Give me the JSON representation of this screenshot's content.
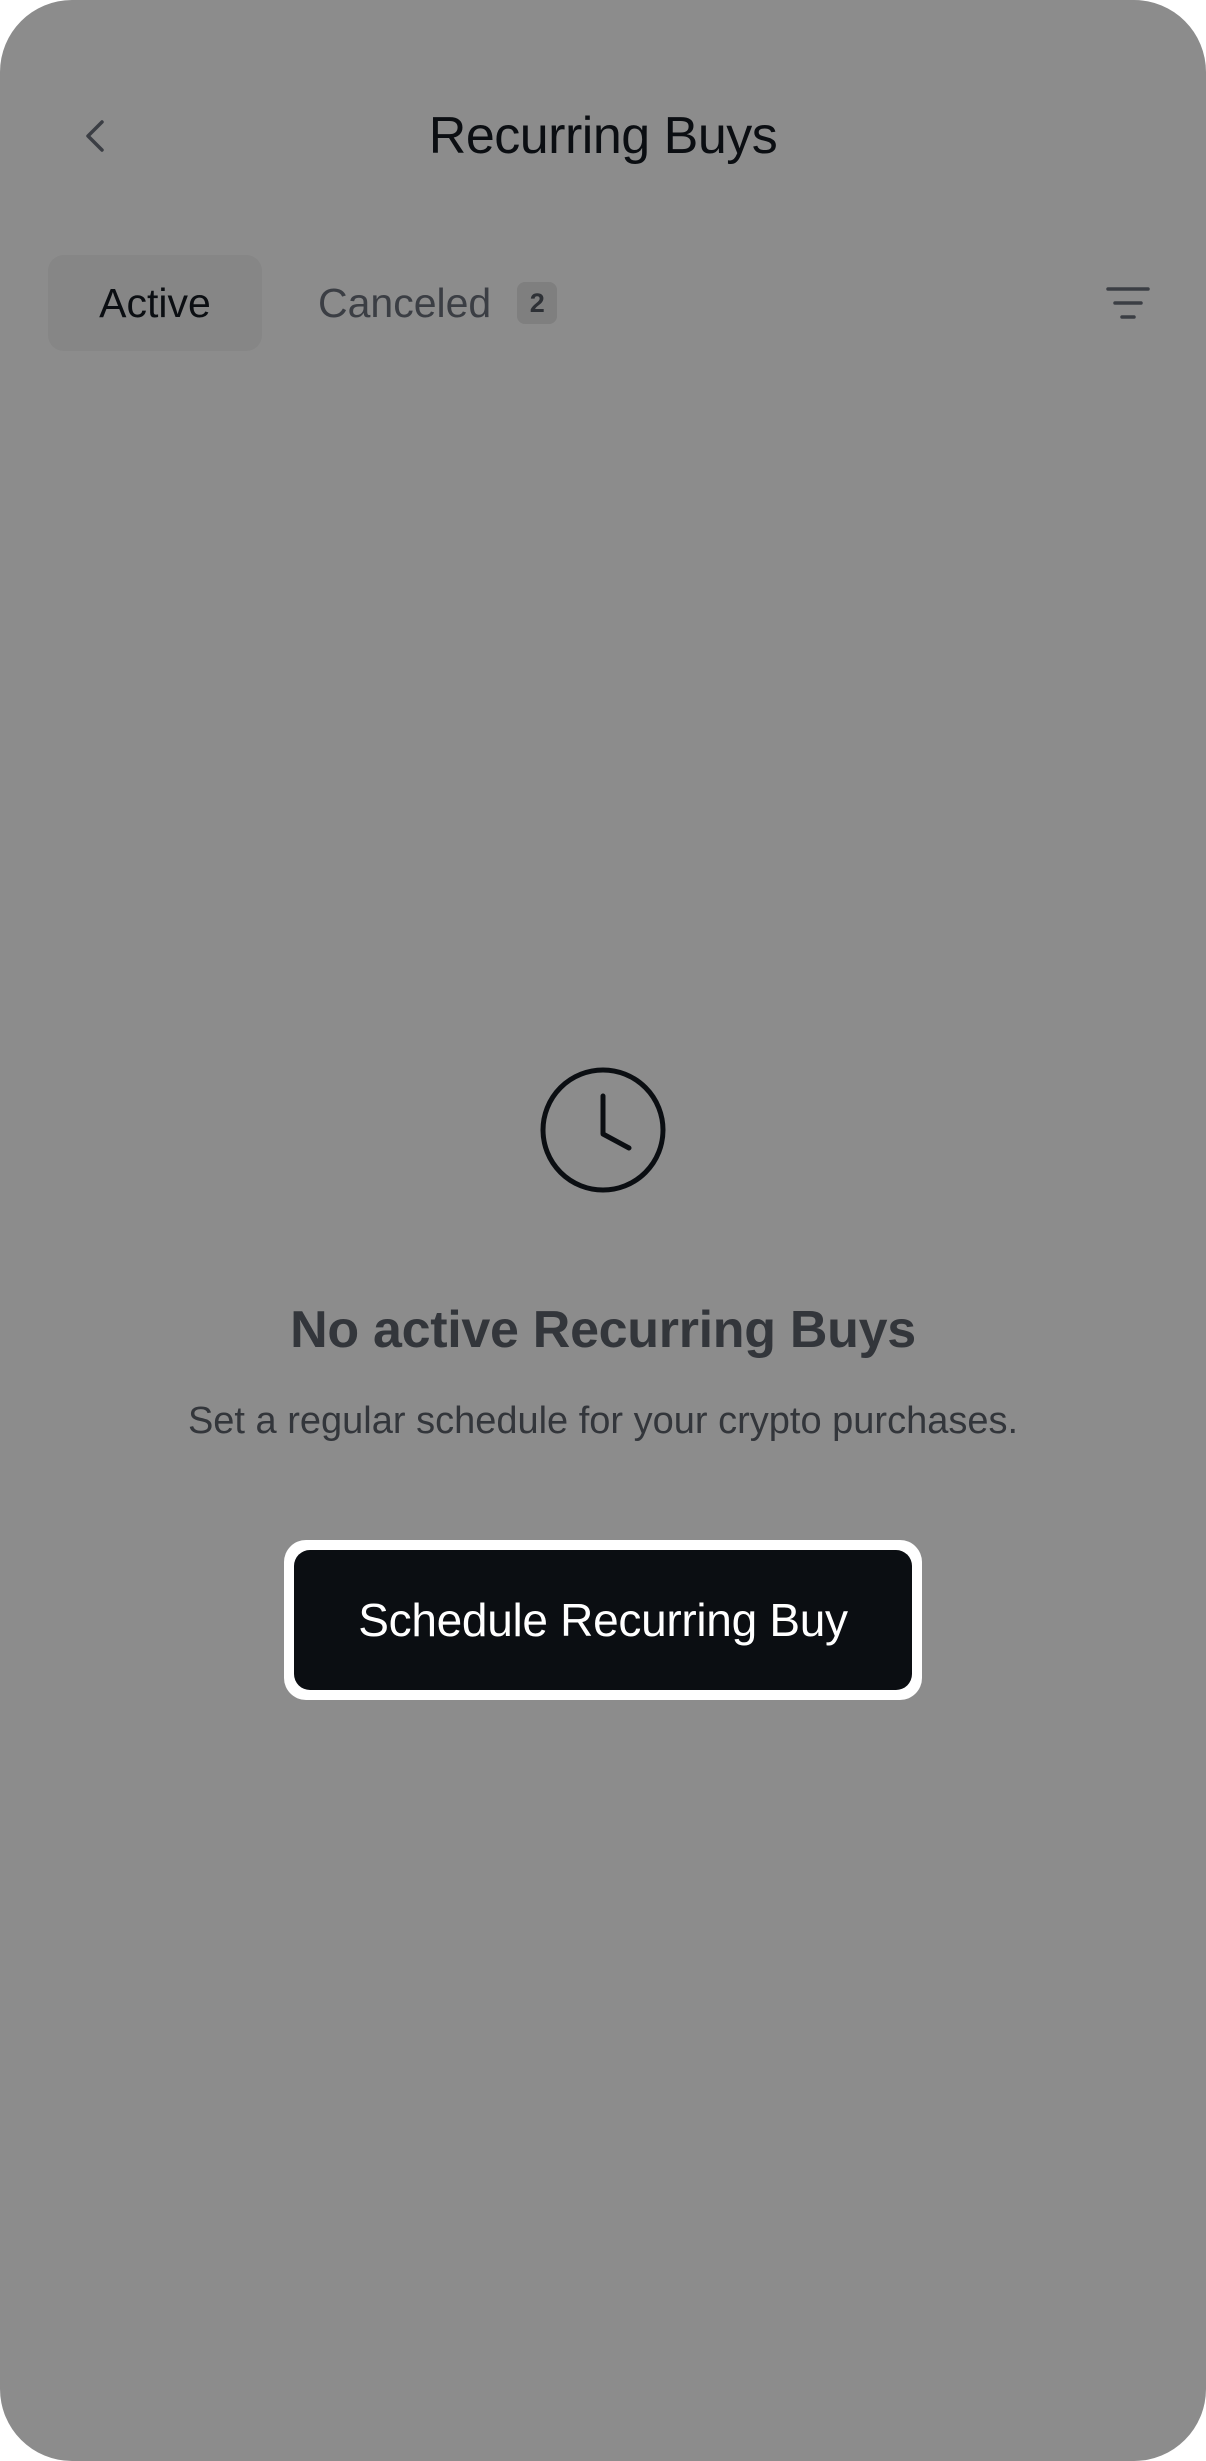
{
  "header": {
    "title": "Recurring Buys",
    "back_icon": "chevron-left-icon"
  },
  "tabs": {
    "active_label": "Active",
    "canceled_label": "Canceled",
    "canceled_count": "2",
    "filter_icon": "filter-icon"
  },
  "empty_state": {
    "icon": "clock-icon",
    "title": "No active Recurring Buys",
    "subtitle": "Set a regular schedule for your crypto purchases.",
    "button_label": "Schedule Recurring Buy"
  },
  "colors": {
    "overlay_background": "#8c8c8c",
    "primary_button": "#0b0e12",
    "button_highlight_ring": "#ffffff"
  }
}
